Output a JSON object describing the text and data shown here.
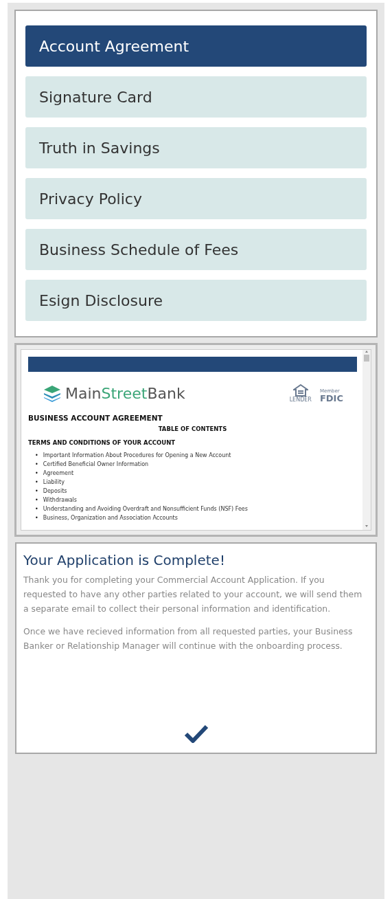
{
  "documents": [
    {
      "label": "Account Agreement",
      "selected": true
    },
    {
      "label": "Signature Card",
      "selected": false
    },
    {
      "label": "Truth in Savings",
      "selected": false
    },
    {
      "label": "Privacy Policy",
      "selected": false
    },
    {
      "label": "Business Schedule of Fees",
      "selected": false
    },
    {
      "label": "Esign Disclosure",
      "selected": false
    }
  ],
  "viewer": {
    "logo": {
      "first": "Main",
      "middle": "Street",
      "last": "Bank"
    },
    "lender_label": "LENDER",
    "fdic": {
      "member": "Member",
      "name": "FDIC"
    },
    "title": "BUSINESS ACCOUNT AGREEMENT",
    "contents_heading": "TABLE OF CONTENTS",
    "section_heading": "TERMS AND CONDITIONS OF YOUR ACCOUNT",
    "items": [
      {
        "marker": "•",
        "text": "Important Information About Procedures for Opening a New Account"
      },
      {
        "marker": "•",
        "text": "Certified Beneficial Owner Information"
      },
      {
        "marker": "•",
        "text": "Agreement"
      },
      {
        "marker": "•",
        "text": "Liability"
      },
      {
        "marker": "•",
        "text": "Deposits"
      },
      {
        "marker": "•",
        "text": "Withdrawals"
      },
      {
        "marker": "•",
        "text": "Understanding and Avoiding Overdraft and Nonsufficient Funds (NSF) Fees"
      },
      {
        "marker": "•",
        "text": "Business, Organization and Association Accounts"
      }
    ]
  },
  "completion": {
    "title": "Your Application is Complete!",
    "paragraphs": [
      "Thank you for completing your Commercial Account Application. If you requested to have any other parties related to your account, we will send them a separate email to collect their personal information and identification.",
      "Once we have recieved information from all requested parties, your Business Banker or Relationship Manager will continue with the onboarding process."
    ]
  }
}
